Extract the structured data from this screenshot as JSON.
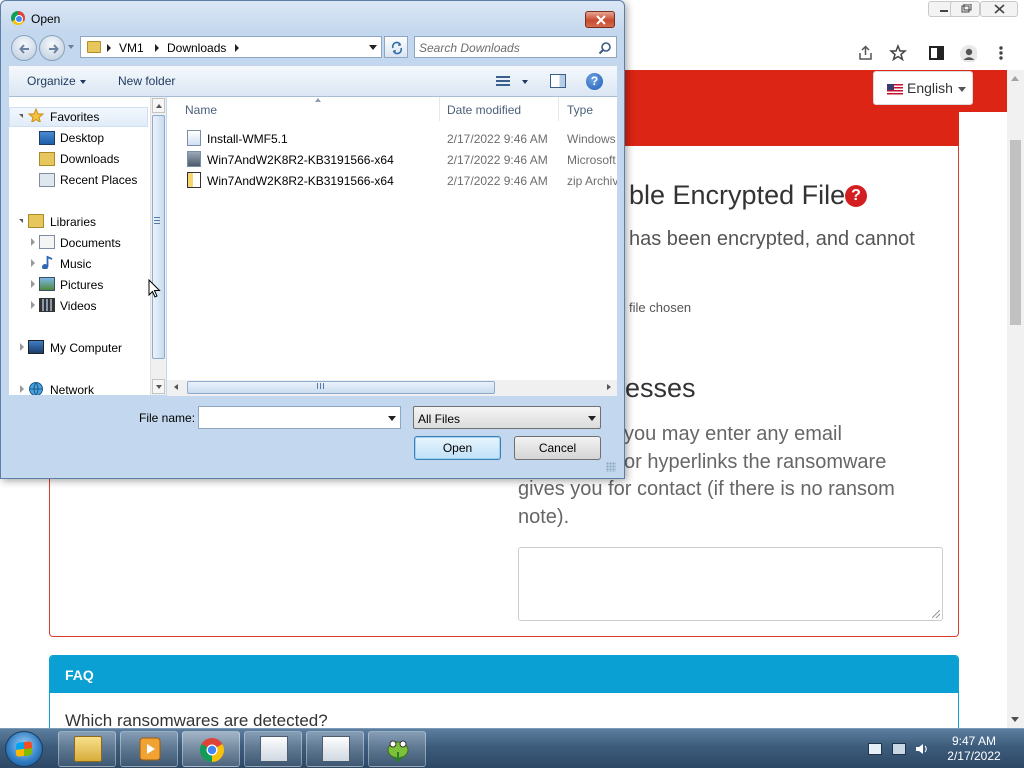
{
  "browser": {
    "language_label": "English"
  },
  "page": {
    "title_fragment": "ble Encrypted File",
    "line_fragment": "has been encrypted, and cannot",
    "file_chosen_fragment": "file chosen",
    "heading_fragment": "esses",
    "para_line1": "you may enter any email",
    "para_line2": "or hyperlinks the ransomware",
    "para_line3": "gives you for contact (if there is no ransom",
    "para_line4": "note).",
    "faq_title": "FAQ",
    "faq_question": "Which ransomwares are detected?"
  },
  "dialog": {
    "title": "Open",
    "breadcrumb": [
      "VM1",
      "Downloads"
    ],
    "search_placeholder": "Search Downloads",
    "toolbar": {
      "organize": "Organize",
      "new_folder": "New folder"
    },
    "nav": {
      "favorites": "Favorites",
      "desktop": "Desktop",
      "downloads": "Downloads",
      "recent_places": "Recent Places",
      "libraries": "Libraries",
      "documents": "Documents",
      "music": "Music",
      "pictures": "Pictures",
      "videos": "Videos",
      "my_computer": "My Computer",
      "network": "Network"
    },
    "columns": {
      "name": "Name",
      "date_modified": "Date modified",
      "type": "Type"
    },
    "files": [
      {
        "name": "Install-WMF5.1",
        "date": "2/17/2022 9:46 AM",
        "type": "Windows"
      },
      {
        "name": "Win7AndW2K8R2-KB3191566-x64",
        "date": "2/17/2022 9:46 AM",
        "type": "Microsoft"
      },
      {
        "name": "Win7AndW2K8R2-KB3191566-x64",
        "date": "2/17/2022 9:46 AM",
        "type": "zip Archive"
      }
    ],
    "file_name_label": "File name:",
    "file_name_value": "",
    "filter_value": "All Files",
    "open_button": "Open",
    "cancel_button": "Cancel"
  },
  "taskbar": {
    "time": "9:47 AM",
    "date": "2/17/2022"
  },
  "colors": {
    "site_red": "#dc2515",
    "faq_blue": "#0aa0d4"
  }
}
